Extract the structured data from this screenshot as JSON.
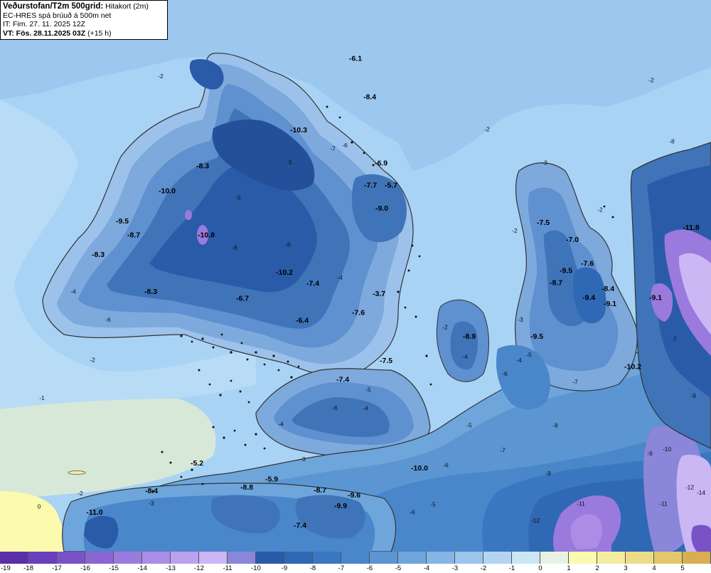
{
  "header": {
    "title": "Veðurstofan/T2m 500grid:",
    "title_sub": "Hitakort (2m)",
    "model_line": "EC-HRES spá brúuð á 500m net",
    "it_line": "IT: Fim. 27. 11. 2025 12Z",
    "vt_label": "VT: Fös. 28.11.2025 03Z",
    "vt_sub": "(+15 h)"
  },
  "colorbar": {
    "ticks": [
      "-19",
      "-18",
      "-17",
      "-16",
      "-15",
      "-14",
      "-13",
      "-12",
      "-11",
      "-10",
      "-9",
      "-8",
      "-7",
      "-6",
      "-5",
      "-4",
      "-3",
      "-2",
      "-1",
      "0",
      "1",
      "2",
      "3",
      "4",
      "5"
    ],
    "colors": [
      "#5a2fa8",
      "#6a3fbb",
      "#7a52c8",
      "#8a66d3",
      "#9b7add",
      "#ab8de6",
      "#bba2ee",
      "#cab7f4",
      "#8a86d9",
      "#2a5ba8",
      "#2f68b5",
      "#3b77c0",
      "#4a86ca",
      "#5b96d3",
      "#6ea6dc",
      "#83b6e4",
      "#9ac6ec",
      "#b3d5f2",
      "#cbe6f5",
      "#e8f2e4",
      "#fafab0",
      "#f4eda0",
      "#ecdc88",
      "#e2c76c",
      "#d8ae52"
    ]
  },
  "map_labels": [
    {
      "text": "-6.1",
      "bold": true,
      "x": 50,
      "y": 11
    },
    {
      "text": "-8.4",
      "bold": true,
      "x": 52,
      "y": 18
    },
    {
      "text": "-10.3",
      "bold": true,
      "x": 42,
      "y": 24
    },
    {
      "text": "-8.3",
      "bold": true,
      "x": 28.5,
      "y": 30.5
    },
    {
      "text": "-6.9",
      "bold": true,
      "x": 53.6,
      "y": 30
    },
    {
      "text": "-7.7",
      "bold": true,
      "x": 52.1,
      "y": 34
    },
    {
      "text": "-5.7",
      "bold": true,
      "x": 55,
      "y": 34
    },
    {
      "text": "-10.0",
      "bold": true,
      "x": 23.5,
      "y": 35
    },
    {
      "text": "-9.0",
      "bold": true,
      "x": 53.7,
      "y": 38.2
    },
    {
      "text": "-9.5",
      "bold": true,
      "x": 17.2,
      "y": 40.5
    },
    {
      "text": "-8.7",
      "bold": true,
      "x": 18.8,
      "y": 43
    },
    {
      "text": "-10.8",
      "bold": true,
      "x": 29,
      "y": 43
    },
    {
      "text": "-8.3",
      "bold": true,
      "x": 13.8,
      "y": 46.6
    },
    {
      "text": "-10.2",
      "bold": true,
      "x": 40,
      "y": 49.8
    },
    {
      "text": "-7.4",
      "bold": true,
      "x": 44,
      "y": 51.8
    },
    {
      "text": "-8.3",
      "bold": true,
      "x": 21.2,
      "y": 53.3
    },
    {
      "text": "-6.7",
      "bold": true,
      "x": 34.1,
      "y": 54.5
    },
    {
      "text": "-3.7",
      "bold": true,
      "x": 53.3,
      "y": 53.7
    },
    {
      "text": "-7.6",
      "bold": true,
      "x": 50.4,
      "y": 57.1
    },
    {
      "text": "-6.4",
      "bold": true,
      "x": 42.5,
      "y": 58.5
    },
    {
      "text": "-7.5",
      "bold": true,
      "x": 54.3,
      "y": 65.8
    },
    {
      "text": "-7.4",
      "bold": true,
      "x": 48.2,
      "y": 69.2
    },
    {
      "text": "-7.5",
      "bold": true,
      "x": 76.4,
      "y": 40.8
    },
    {
      "text": "-7.0",
      "bold": true,
      "x": 80.5,
      "y": 43.9
    },
    {
      "text": "-9.5",
      "bold": true,
      "x": 79.6,
      "y": 49.5
    },
    {
      "text": "-7.6",
      "bold": true,
      "x": 82.6,
      "y": 48.2
    },
    {
      "text": "-8.7",
      "bold": true,
      "x": 78.2,
      "y": 51.7
    },
    {
      "text": "-8.4",
      "bold": true,
      "x": 85.5,
      "y": 52.8
    },
    {
      "text": "-9.4",
      "bold": true,
      "x": 82.8,
      "y": 54.4
    },
    {
      "text": "-9.1",
      "bold": true,
      "x": 85.8,
      "y": 55.5
    },
    {
      "text": "-11.8",
      "bold": true,
      "x": 97.2,
      "y": 41.7
    },
    {
      "text": "-9.1",
      "bold": true,
      "x": 92.2,
      "y": 54.4
    },
    {
      "text": "-8.9",
      "bold": true,
      "x": 66,
      "y": 61.4
    },
    {
      "text": "-9.5",
      "bold": true,
      "x": 75.5,
      "y": 61.4
    },
    {
      "text": "-10.2",
      "bold": true,
      "x": 89,
      "y": 66.9
    },
    {
      "text": "-10.0",
      "bold": true,
      "x": 59,
      "y": 85.3
    },
    {
      "text": "-5.2",
      "bold": true,
      "x": 27.7,
      "y": 84.4
    },
    {
      "text": "-5.9",
      "bold": true,
      "x": 38.2,
      "y": 87.3
    },
    {
      "text": "-8.4",
      "bold": true,
      "x": 21.3,
      "y": 89.4
    },
    {
      "text": "-8.8",
      "bold": true,
      "x": 34.7,
      "y": 88.8
    },
    {
      "text": "-8.7",
      "bold": true,
      "x": 45,
      "y": 89.3
    },
    {
      "text": "-9.6",
      "bold": true,
      "x": 49.8,
      "y": 90.2
    },
    {
      "text": "-9.9",
      "bold": true,
      "x": 47.9,
      "y": 92.1
    },
    {
      "text": "-11.0",
      "bold": true,
      "x": 13.3,
      "y": 93.3
    },
    {
      "text": "-7.4",
      "bold": true,
      "x": 42.2,
      "y": 95.7
    },
    {
      "text": "-2",
      "bold": false,
      "x": 22.6,
      "y": 14.2
    },
    {
      "text": "-2",
      "bold": false,
      "x": 91.6,
      "y": 14.9
    },
    {
      "text": "-2",
      "bold": false,
      "x": 68.5,
      "y": 23.8
    },
    {
      "text": "-2",
      "bold": false,
      "x": 72.4,
      "y": 42.2
    },
    {
      "text": "-2",
      "bold": false,
      "x": 13,
      "y": 65.6
    },
    {
      "text": "-1",
      "bold": false,
      "x": 5.9,
      "y": 72.5
    },
    {
      "text": "0",
      "bold": false,
      "x": 5.5,
      "y": 92.2
    },
    {
      "text": "-2",
      "bold": false,
      "x": 11.3,
      "y": 89.8
    },
    {
      "text": "-3",
      "bold": false,
      "x": 42.6,
      "y": 83.6
    },
    {
      "text": "-3",
      "bold": false,
      "x": 21.3,
      "y": 91.6
    },
    {
      "text": "-4",
      "bold": false,
      "x": 51.4,
      "y": 74.4
    },
    {
      "text": "-5",
      "bold": false,
      "x": 60.9,
      "y": 91.8
    },
    {
      "text": "-6",
      "bold": false,
      "x": 62.7,
      "y": 84.7
    },
    {
      "text": "-7",
      "bold": false,
      "x": 70.7,
      "y": 82
    },
    {
      "text": "-8",
      "bold": false,
      "x": 78.1,
      "y": 77.5
    },
    {
      "text": "-9",
      "bold": false,
      "x": 91.4,
      "y": 82.6
    },
    {
      "text": "-10",
      "bold": false,
      "x": 93.8,
      "y": 81.8
    },
    {
      "text": "-9",
      "bold": false,
      "x": 77.1,
      "y": 86.2
    },
    {
      "text": "-11",
      "bold": false,
      "x": 81.7,
      "y": 91.7
    },
    {
      "text": "-12",
      "bold": false,
      "x": 75.3,
      "y": 94.7
    },
    {
      "text": "-11",
      "bold": false,
      "x": 93.3,
      "y": 91.7
    },
    {
      "text": "-12",
      "bold": false,
      "x": 97,
      "y": 88.7
    },
    {
      "text": "-14",
      "bold": false,
      "x": 99.2,
      "y": 89.7
    },
    {
      "text": "-7",
      "bold": false,
      "x": 94.8,
      "y": 61.8
    },
    {
      "text": "-9",
      "bold": false,
      "x": 97.5,
      "y": 72.1
    },
    {
      "text": "-8",
      "bold": false,
      "x": 94.5,
      "y": 26
    },
    {
      "text": "-3",
      "bold": false,
      "x": 76.6,
      "y": 29.9
    },
    {
      "text": "-2",
      "bold": false,
      "x": 84.4,
      "y": 38.4
    },
    {
      "text": "-4",
      "bold": false,
      "x": 10.3,
      "y": 53.2
    },
    {
      "text": "-6",
      "bold": false,
      "x": 15.2,
      "y": 58.3
    },
    {
      "text": "-5",
      "bold": false,
      "x": 33.5,
      "y": 36.2
    },
    {
      "text": "-7",
      "bold": false,
      "x": 46.8,
      "y": 27.3
    },
    {
      "text": "-6",
      "bold": false,
      "x": 48.5,
      "y": 26.7
    },
    {
      "text": "-5",
      "bold": false,
      "x": 40.7,
      "y": 29.8
    },
    {
      "text": "-6",
      "bold": false,
      "x": 40.5,
      "y": 44.7
    },
    {
      "text": "-8",
      "bold": false,
      "x": 33,
      "y": 45.3
    },
    {
      "text": "-4",
      "bold": false,
      "x": 47.8,
      "y": 50.7
    },
    {
      "text": "-5",
      "bold": false,
      "x": 51.8,
      "y": 71
    },
    {
      "text": "-4",
      "bold": false,
      "x": 39.5,
      "y": 77.2
    },
    {
      "text": "-6",
      "bold": false,
      "x": 47.1,
      "y": 74.3
    },
    {
      "text": "-6",
      "bold": false,
      "x": 58,
      "y": 93.2
    },
    {
      "text": "-5",
      "bold": false,
      "x": 66,
      "y": 77.5
    },
    {
      "text": "-3",
      "bold": false,
      "x": 73.2,
      "y": 58.3
    },
    {
      "text": "-4",
      "bold": false,
      "x": 73,
      "y": 65.7
    },
    {
      "text": "-5",
      "bold": false,
      "x": 74.4,
      "y": 64.7
    },
    {
      "text": "-6",
      "bold": false,
      "x": 71,
      "y": 68.1
    },
    {
      "text": "-4",
      "bold": false,
      "x": 65.4,
      "y": 65
    },
    {
      "text": "-2",
      "bold": false,
      "x": 62.6,
      "y": 59.7
    },
    {
      "text": "-7",
      "bold": false,
      "x": 80.9,
      "y": 69.6
    }
  ]
}
